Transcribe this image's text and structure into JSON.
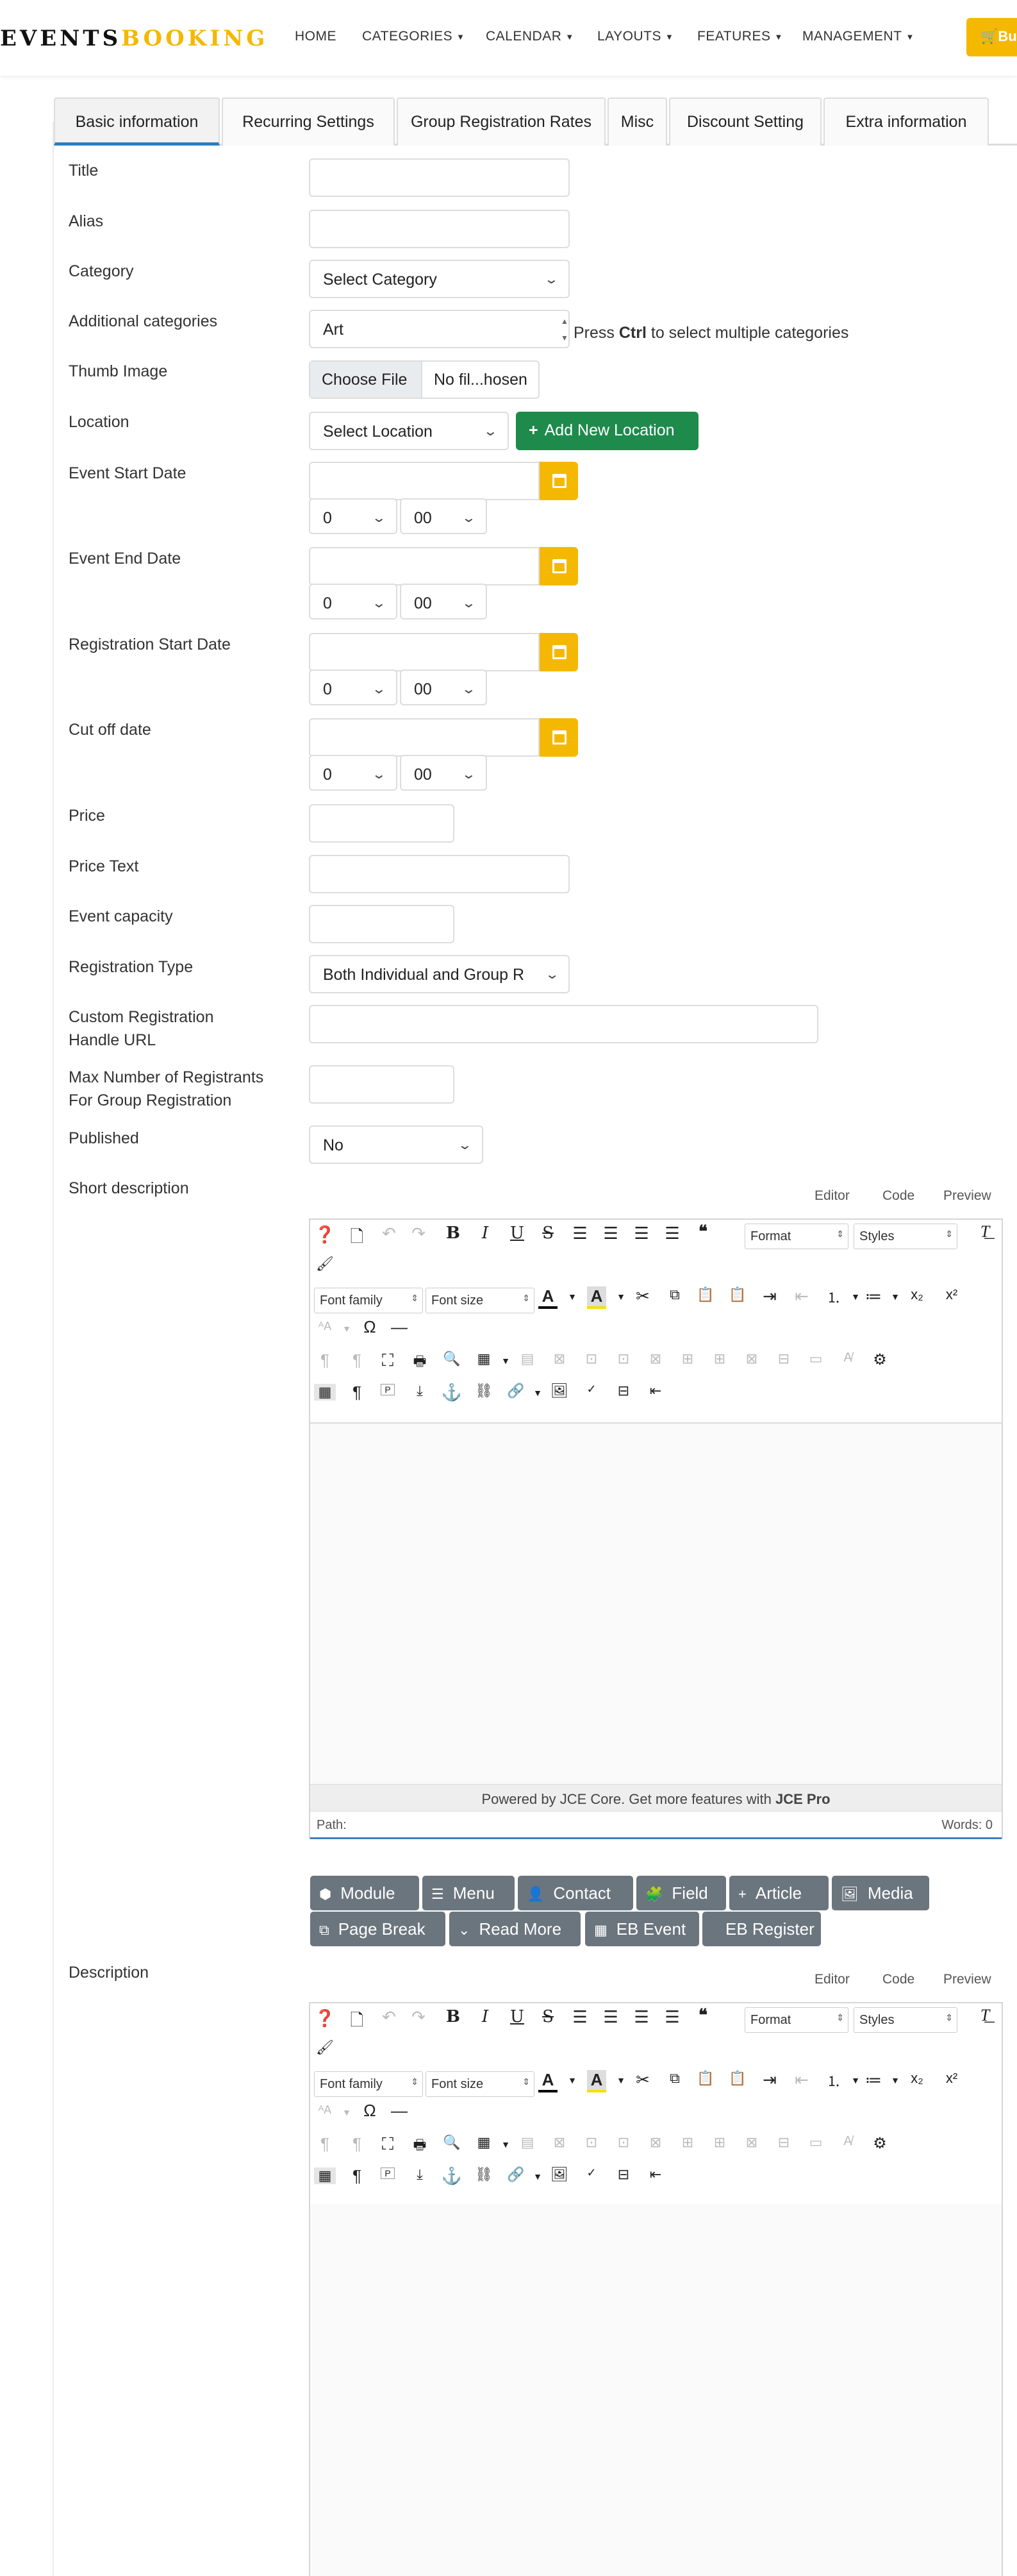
{
  "header": {
    "logo_left": "EVENTS",
    "logo_right": "BOOKING",
    "nav": [
      "HOME",
      "CATEGORIES",
      "CALENDAR",
      "LAYOUTS",
      "FEATURES",
      "MANAGEMENT"
    ],
    "buy_label": "Bu"
  },
  "tabs": [
    "Basic information",
    "Recurring Settings",
    "Group Registration Rates",
    "Misc",
    "Discount Setting",
    "Extra information"
  ],
  "form": {
    "title": "Title",
    "alias": "Alias",
    "category": "Category",
    "category_value": "Select Category",
    "additional_categories": "Additional categories",
    "additional_value": "Art",
    "help_pre": "Press ",
    "help_key": "Ctrl",
    "help_post": " to select multiple categories",
    "thumb": "Thumb Image",
    "choose_file": "Choose File",
    "no_file": "No fil...hosen",
    "location": "Location",
    "location_value": "Select Location",
    "add_location": "Add New Location",
    "event_start": "Event Start Date",
    "event_end": "Event End Date",
    "reg_start": "Registration Start Date",
    "cutoff": "Cut off date",
    "hour": "0",
    "minute": "00",
    "price": "Price",
    "price_text": "Price Text",
    "capacity": "Event capacity",
    "reg_type": "Registration Type",
    "reg_type_value": "Both Individual and Group R",
    "custom_url_1": "Custom Registration",
    "custom_url_2": "Handle URL",
    "max_1": "Max Number of Registrants",
    "max_2": "For Group Registration",
    "published": "Published",
    "published_value": "No",
    "short_desc": "Short description",
    "description": "Description"
  },
  "editor": {
    "links": [
      "Editor",
      "Code",
      "Preview"
    ],
    "format": "Format",
    "styles": "Styles",
    "font_family": "Font family",
    "font_size": "Font size",
    "powered_pre": "Powered by JCE Core. Get more features with ",
    "powered_bold": "JCE Pro",
    "path": "Path:",
    "words": "Words: 0"
  },
  "plugin_buttons": [
    "Module",
    "Menu",
    "Contact",
    "Field",
    "Article",
    "Media",
    "Page Break",
    "Read More",
    "EB Event",
    "EB Register"
  ]
}
